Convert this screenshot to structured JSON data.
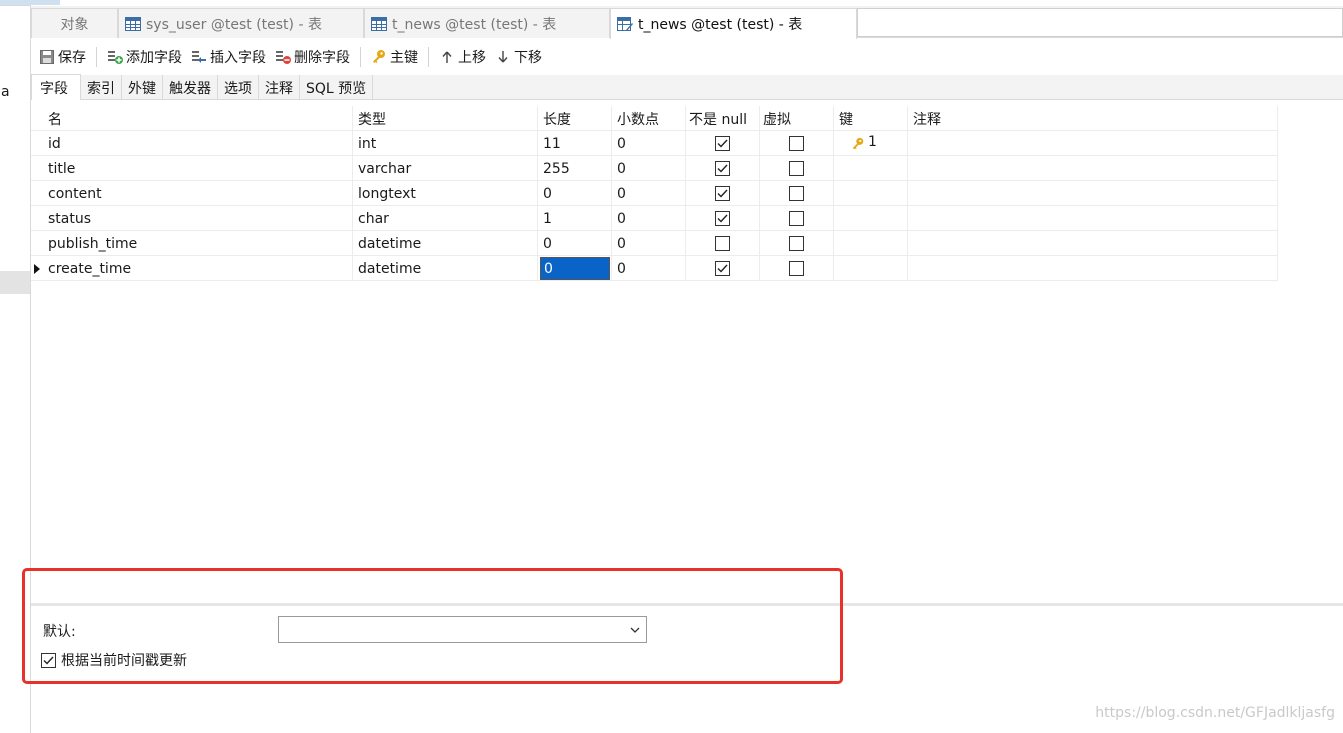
{
  "sidebar": {
    "letter": "a"
  },
  "tabs": [
    {
      "label": "对象",
      "icon": "none",
      "active": false
    },
    {
      "label": "sys_user @test (test) - 表",
      "icon": "table-icon",
      "active": false
    },
    {
      "label": "t_news @test (test) - 表",
      "icon": "table-icon",
      "active": false
    },
    {
      "label": "t_news @test (test) - 表",
      "icon": "table-design-icon",
      "active": true
    }
  ],
  "toolbar": {
    "save": "保存",
    "add_field": "添加字段",
    "insert_field": "插入字段",
    "delete_field": "删除字段",
    "primary_key": "主键",
    "move_up": "上移",
    "move_down": "下移"
  },
  "subtabs": [
    "字段",
    "索引",
    "外键",
    "触发器",
    "选项",
    "注释",
    "SQL 预览"
  ],
  "grid": {
    "headers": [
      "名",
      "类型",
      "长度",
      "小数点",
      "不是 null",
      "虚拟",
      "键",
      "注释"
    ],
    "rows": [
      {
        "name": "id",
        "type": "int",
        "length": "11",
        "decimals": "0",
        "not_null": true,
        "virtual": false,
        "key": "1",
        "comment": ""
      },
      {
        "name": "title",
        "type": "varchar",
        "length": "255",
        "decimals": "0",
        "not_null": true,
        "virtual": false,
        "key": "",
        "comment": ""
      },
      {
        "name": "content",
        "type": "longtext",
        "length": "0",
        "decimals": "0",
        "not_null": true,
        "virtual": false,
        "key": "",
        "comment": ""
      },
      {
        "name": "status",
        "type": "char",
        "length": "1",
        "decimals": "0",
        "not_null": true,
        "virtual": false,
        "key": "",
        "comment": ""
      },
      {
        "name": "publish_time",
        "type": "datetime",
        "length": "0",
        "decimals": "0",
        "not_null": false,
        "virtual": false,
        "key": "",
        "comment": ""
      },
      {
        "name": "create_time",
        "type": "datetime",
        "length": "0",
        "decimals": "0",
        "not_null": true,
        "virtual": false,
        "key": "",
        "comment": ""
      }
    ]
  },
  "properties": {
    "default_label": "默认:",
    "default_value": "",
    "on_update_label": "根据当前时间戳更新",
    "on_update_checked": true
  },
  "colors": {
    "highlight": "#e8312a",
    "selection": "#0a64c8",
    "key_icon": "#e6a817"
  },
  "watermark": "https://blog.csdn.net/GFJadlkljasfg"
}
